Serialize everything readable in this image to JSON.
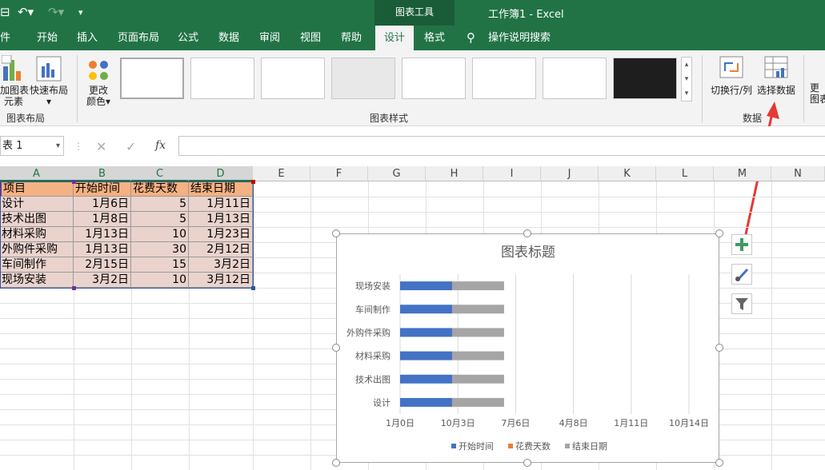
{
  "window": {
    "title": "工作簿1  -  Excel",
    "context_tab_header": "图表工具"
  },
  "tabs": [
    "件",
    "开始",
    "插入",
    "页面布局",
    "公式",
    "数据",
    "审阅",
    "视图",
    "帮助",
    "设计",
    "格式"
  ],
  "tell_me": "操作说明搜索",
  "ribbon": {
    "add_element_label": "加图表",
    "add_element_label2": "元素",
    "quick_layout_label": "快速布局",
    "group_layout": "图表布局",
    "change_color_label": "更改",
    "change_color_label2": "颜色",
    "group_styles": "图表样式",
    "switch_row_col": "切换行/列",
    "select_data": "选择数据",
    "group_data": "数据",
    "next_label": "更",
    "next_label2": "图表"
  },
  "formula_bar": {
    "name_box": "表 1",
    "fx": "fx"
  },
  "columns": [
    "A",
    "B",
    "C",
    "D",
    "E",
    "F",
    "G",
    "H",
    "I",
    "J",
    "K",
    "L",
    "M",
    "N"
  ],
  "table": {
    "headers": [
      "项目",
      "开始时间",
      "花费天数",
      "结束日期"
    ],
    "rows": [
      [
        "设计",
        "1月6日",
        "5",
        "1月11日"
      ],
      [
        "技术出图",
        "1月8日",
        "5",
        "1月13日"
      ],
      [
        "材料采购",
        "1月13日",
        "10",
        "1月23日"
      ],
      [
        "外购件采购",
        "1月13日",
        "30",
        "2月12日"
      ],
      [
        "车间制作",
        "2月15日",
        "15",
        "3月2日"
      ],
      [
        "现场安装",
        "3月2日",
        "10",
        "3月12日"
      ]
    ]
  },
  "chart_data": {
    "type": "bar",
    "title": "图表标题",
    "categories": [
      "设计",
      "技术出图",
      "材料采购",
      "外购件采购",
      "车间制作",
      "现场安装"
    ],
    "x_tick_labels": [
      "1月0日",
      "10月3日",
      "7月6日",
      "4月8日",
      "1月11日",
      "10月14日"
    ],
    "series": [
      {
        "name": "开始时间",
        "color": "#4472c4",
        "values": [
          0.5,
          0.5,
          0.5,
          0.5,
          0.5,
          0.5
        ]
      },
      {
        "name": "花费天数",
        "color": "#ed7d31",
        "values": [
          0,
          0,
          0,
          0,
          0,
          0
        ]
      },
      {
        "name": "结束日期",
        "color": "#a5a5a5",
        "values": [
          0.5,
          0.5,
          0.5,
          0.5,
          0.5,
          0.5
        ]
      }
    ],
    "legend": "bottom",
    "xlim_ticks": 6
  }
}
